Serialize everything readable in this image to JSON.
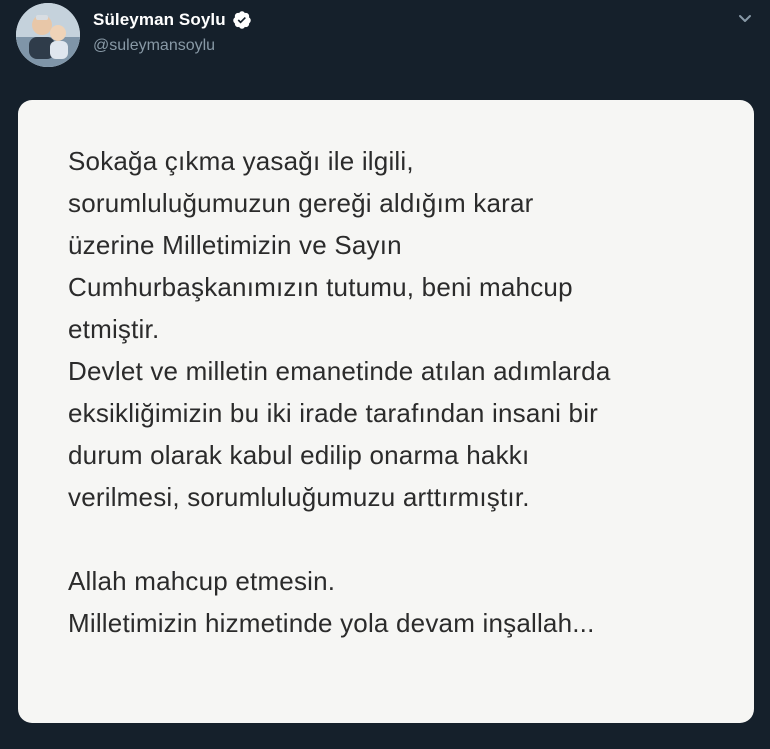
{
  "tweet": {
    "author": {
      "display_name": "Süleyman Soylu",
      "handle": "@suleymansoylu",
      "verified_icon": "verified-badge-icon",
      "avatar_icon": "profile-avatar"
    },
    "menu_icon": "chevron-down-icon",
    "media": {
      "text_lines": "Sokağa çıkma yasağı ile ilgili,\nsorumluluğumuzun gereği aldığım karar\nüzerine Milletimizin ve Sayın\nCumhurbaşkanımızın tutumu, beni mahcup\netmiştir.\nDevlet ve milletin emanetinde atılan adımlarda\neksikliğimizin bu iki irade tarafından insani bir\ndurum olarak kabul edilip onarma hakkı\nverilmesi, sorumluluğumuzu arttırmıştır.\n\nAllah mahcup etmesin.\nMilletimizin hizmetinde yola devam inşallah..."
    }
  },
  "colors": {
    "background": "#15202b",
    "name": "#ffffff",
    "handle": "#8899a6",
    "card": "#f6f6f4",
    "note_text": "#2b2b2b"
  }
}
